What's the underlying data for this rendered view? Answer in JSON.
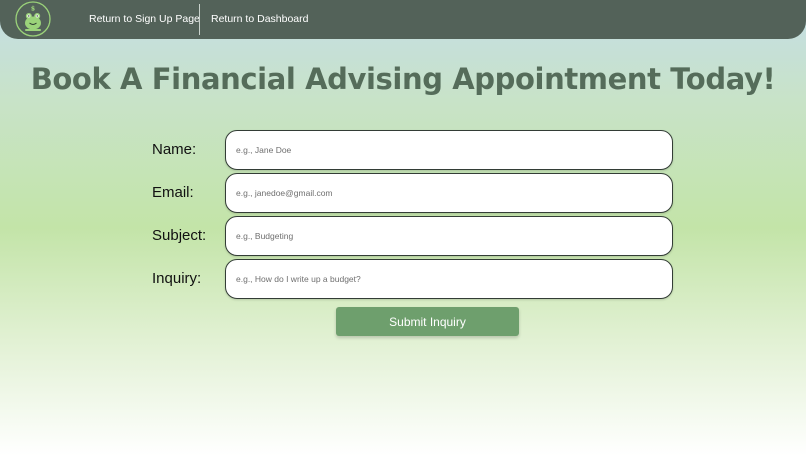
{
  "nav": {
    "links": [
      {
        "label": "Return to Sign Up Page"
      },
      {
        "label": "Return to Dashboard"
      }
    ]
  },
  "page": {
    "title": "Book A Financial Advising Appointment Today!"
  },
  "form": {
    "fields": [
      {
        "label": "Name:",
        "placeholder": "e.g., Jane Doe",
        "value": ""
      },
      {
        "label": "Email:",
        "placeholder": "e.g., janedoe@gmail.com",
        "value": ""
      },
      {
        "label": "Subject:",
        "placeholder": "e.g., Budgeting",
        "value": ""
      },
      {
        "label": "Inquiry:",
        "placeholder": "e.g., How do I write up a budget?",
        "value": ""
      }
    ],
    "submit_label": "Submit Inquiry"
  },
  "colors": {
    "navbar": "#536259",
    "title": "#556c5a",
    "button": "#6e9f6d",
    "logo_ring": "#9bd37a"
  },
  "icons": {
    "logo": "frog-money-logo-icon"
  }
}
